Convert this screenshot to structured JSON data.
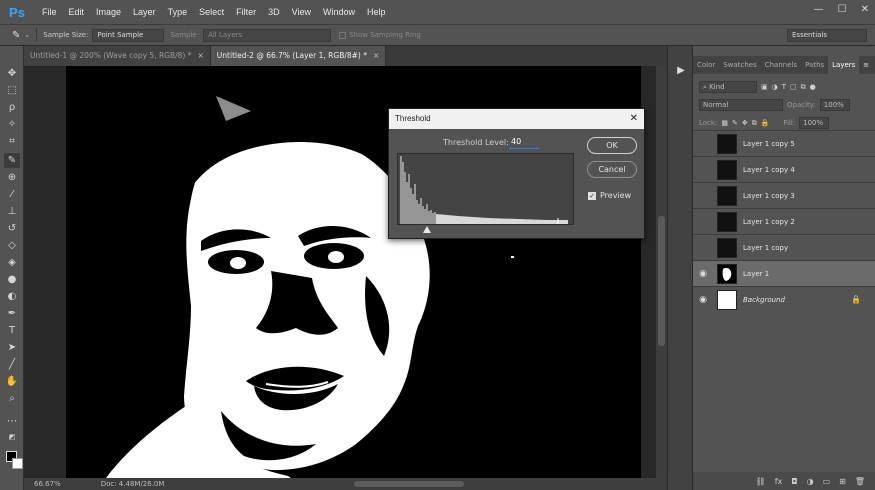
{
  "app": {
    "logo": "Ps"
  },
  "menu": [
    "File",
    "Edit",
    "Image",
    "Layer",
    "Type",
    "Select",
    "Filter",
    "3D",
    "View",
    "Window",
    "Help"
  ],
  "window_controls": {
    "minimize": "—",
    "maximize": "☐",
    "close": "✕"
  },
  "options_bar": {
    "sample_size_label": "Sample Size:",
    "sample_size_value": "Point Sample",
    "sample_label": "Sample:",
    "sample_value": "All Layers",
    "show_ring_label": "Show Sampling Ring",
    "workspace": "Essentials"
  },
  "tabs": [
    {
      "label": "Untitled-1 @ 200% (Wave copy 5, RGB/8) *",
      "close": "×"
    },
    {
      "label": "Untitled-2 @ 66.7% (Layer 1, RGB/8#) *",
      "close": "×"
    }
  ],
  "status": {
    "zoom": "66.67%",
    "doc": "Doc: 4.48M/26.0M"
  },
  "panel": {
    "tabs": [
      "Color",
      "Swatches",
      "Channels",
      "Paths",
      "Layers"
    ],
    "active_tab": "Layers",
    "kind_label": "Kind",
    "blend_mode": "Normal",
    "opacity_label": "Opacity:",
    "opacity_value": "100%",
    "lock_label": "Lock:",
    "fill_label": "Fill:",
    "fill_value": "100%"
  },
  "layers": [
    {
      "name": "Layer 1 copy 5",
      "visible": false
    },
    {
      "name": "Layer 1 copy 4",
      "visible": false
    },
    {
      "name": "Layer 1 copy 3",
      "visible": false
    },
    {
      "name": "Layer 1 copy 2",
      "visible": false
    },
    {
      "name": "Layer 1 copy",
      "visible": false
    },
    {
      "name": "Layer 1",
      "visible": true,
      "active": true
    },
    {
      "name": "Background",
      "visible": true,
      "locked": true
    }
  ],
  "dialog": {
    "title": "Threshold",
    "close": "✕",
    "level_label": "Threshold Level:",
    "level_value": "40",
    "ok_label": "OK",
    "cancel_label": "Cancel",
    "preview_label": "Preview",
    "preview_checked": true
  },
  "colors": {
    "foreground": "#000000",
    "background": "#ffffff",
    "accent": "#31a8ff"
  }
}
